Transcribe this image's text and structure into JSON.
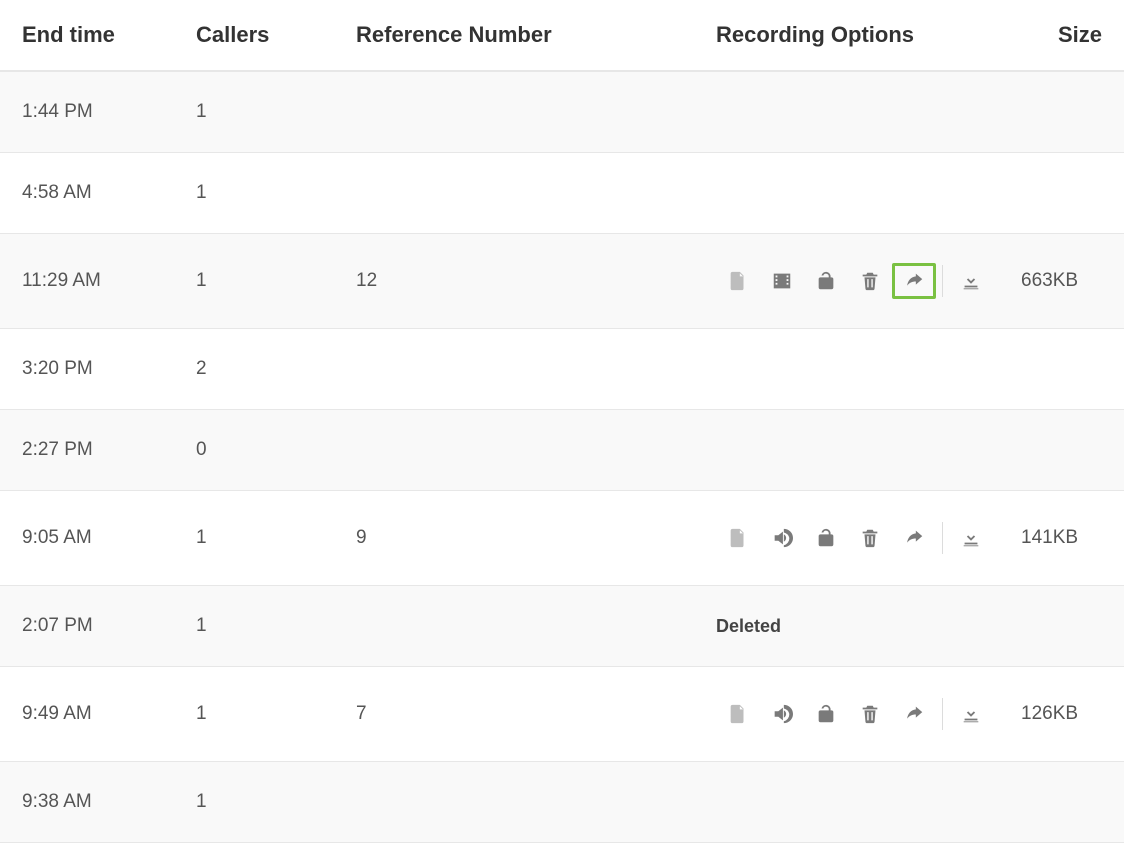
{
  "columns": {
    "end_time": "End time",
    "callers": "Callers",
    "reference": "Reference Number",
    "recording": "Recording Options",
    "size": "Size"
  },
  "rows": [
    {
      "end_time": "1:44 PM",
      "callers": "1",
      "reference": "",
      "type": "empty",
      "size": ""
    },
    {
      "end_time": "4:58 AM",
      "callers": "1",
      "reference": "",
      "type": "empty",
      "size": ""
    },
    {
      "end_time": "11:29 AM",
      "callers": "1",
      "reference": "12",
      "type": "video_hl",
      "size": "663KB"
    },
    {
      "end_time": "3:20 PM",
      "callers": "2",
      "reference": "",
      "type": "empty",
      "size": ""
    },
    {
      "end_time": "2:27 PM",
      "callers": "0",
      "reference": "",
      "type": "empty",
      "size": ""
    },
    {
      "end_time": "9:05 AM",
      "callers": "1",
      "reference": "9",
      "type": "audio",
      "size": "141KB"
    },
    {
      "end_time": "2:07 PM",
      "callers": "1",
      "reference": "",
      "type": "deleted",
      "size": "",
      "deleted_label": "Deleted"
    },
    {
      "end_time": "9:49 AM",
      "callers": "1",
      "reference": "7",
      "type": "audio",
      "size": "126KB"
    },
    {
      "end_time": "9:38 AM",
      "callers": "1",
      "reference": "",
      "type": "empty",
      "size": ""
    }
  ]
}
